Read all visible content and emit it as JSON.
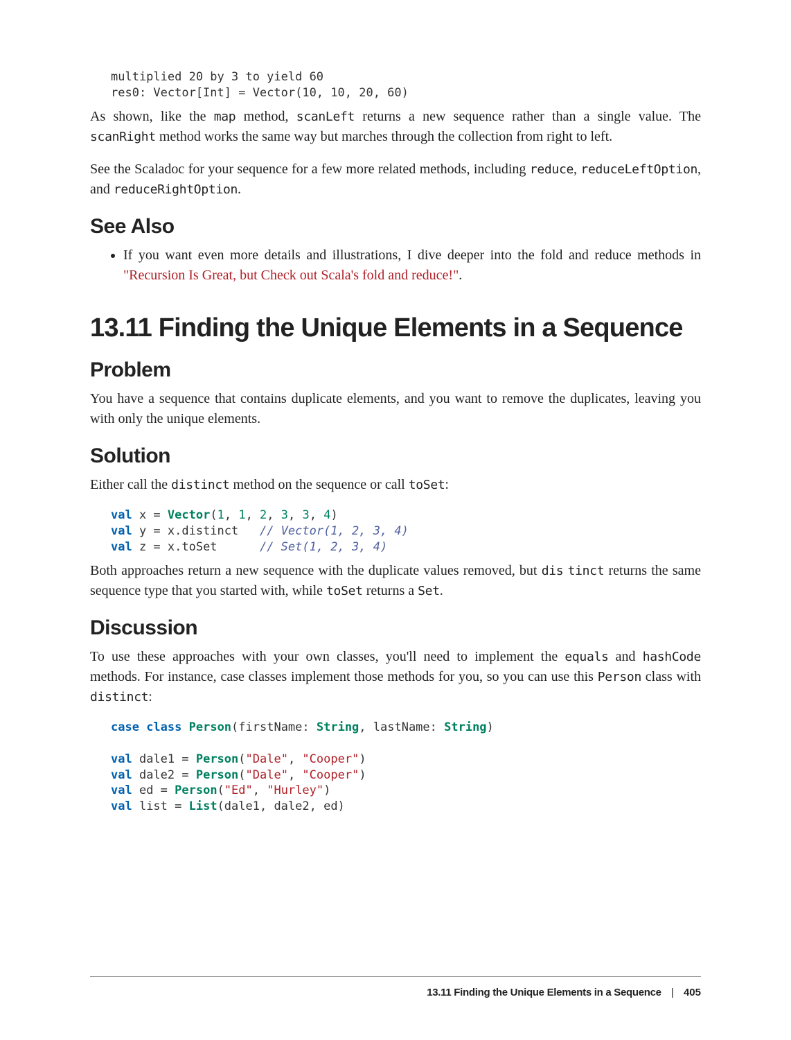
{
  "codeBlock1": "multiplied 20 by 3 to yield 60\nres0: Vector[Int] = Vector(10, 10, 20, 60)",
  "para1_a": "As shown, like the ",
  "para1_b": " method, ",
  "para1_c": " returns a new sequence rather than a single value. The ",
  "para1_d": " method works the same way but marches through the collection from right to left.",
  "code_map": "map",
  "code_scanLeft": "scanLeft",
  "code_scanRight": "scanRight",
  "para2_a": "See the Scaladoc for your sequence for a few more related methods, including ",
  "para2_b": ", ",
  "para2_c": ", and ",
  "para2_d": ".",
  "code_reduce": "reduce",
  "code_reduceLeftOption": "reduceLeftOption",
  "code_reduceRightOption": "reduceRightOption",
  "seeAlso": "See Also",
  "bullet1_a": "If you want even more details and illustrations, I dive deeper into the fold and reduce methods in ",
  "bullet1_link": "\"Recursion Is Great, but Check out Scala's fold and reduce!\"",
  "bullet1_c": ".",
  "sectionTitle": "13.11 Finding the Unique Elements in a Sequence",
  "problemH": "Problem",
  "problemText": "You have a sequence that contains duplicate elements, and you want to remove the duplicates, leaving you with only the unique elements.",
  "solutionH": "Solution",
  "solPara_a": "Either call the ",
  "solPara_b": " method on the sequence or call ",
  "solPara_c": ":",
  "code_distinct": "distinct",
  "code_toSet": "toSet",
  "code2": {
    "l1_val": "val",
    "l1_x": " x = ",
    "l1_Vector": "Vector",
    "l1_open": "(",
    "l1_n1": "1",
    "l1_c": ", ",
    "l1_n2": "1",
    "l1_n3": "2",
    "l1_n4": "3",
    "l1_n5": "3",
    "l1_n6": "4",
    "l1_close": ")",
    "l2_val": "val",
    "l2_rest": " y = x.distinct   ",
    "l2_comment": "// Vector(1, 2, 3, 4)",
    "l3_val": "val",
    "l3_rest": " z = x.toSet      ",
    "l3_comment": "// Set(1, 2, 3, 4)"
  },
  "para3_a": "Both approaches return a new sequence with the duplicate values removed, but ",
  "para3_b": " returns the same sequence type that you started with, while ",
  "para3_c": " returns a ",
  "para3_d": ".",
  "code_dis": "dis",
  "code_tinct": "tinct",
  "code_Set": "Set",
  "discussionH": "Discussion",
  "disc_a": "To use these approaches with your own classes, you'll need to implement the ",
  "disc_b": " and ",
  "disc_c": " methods. For instance, case classes implement those methods for you, so you can use this ",
  "disc_d": " class with ",
  "disc_e": ":",
  "code_equals": "equals",
  "code_hashCode": "hashCode",
  "code_Person": "Person",
  "code3": {
    "l1_case": "case",
    "l1_class": " class",
    "l1_sp": " ",
    "l1_Person": "Person",
    "l1_a": "(firstName: ",
    "l1_String1": "String",
    "l1_b": ", lastName: ",
    "l1_String2": "String",
    "l1_c": ")",
    "l3_val": "val",
    "l3_a": " dale1 = ",
    "l3_Person": "Person",
    "l3_b": "(",
    "l3_s1": "\"Dale\"",
    "l3_c": ", ",
    "l3_s2": "\"Cooper\"",
    "l3_d": ")",
    "l4_val": "val",
    "l4_a": " dale2 = ",
    "l4_Person": "Person",
    "l4_b": "(",
    "l4_s1": "\"Dale\"",
    "l4_c": ", ",
    "l4_s2": "\"Cooper\"",
    "l4_d": ")",
    "l5_val": "val",
    "l5_a": " ed = ",
    "l5_Person": "Person",
    "l5_b": "(",
    "l5_s1": "\"Ed\"",
    "l5_c": ", ",
    "l5_s2": "\"Hurley\"",
    "l5_d": ")",
    "l6_val": "val",
    "l6_a": " list = ",
    "l6_List": "List",
    "l6_b": "(dale1, dale2, ed)"
  },
  "footerTitle": "13.11 Finding the Unique Elements in a Sequence",
  "footerSep": "|",
  "footerPage": "405"
}
